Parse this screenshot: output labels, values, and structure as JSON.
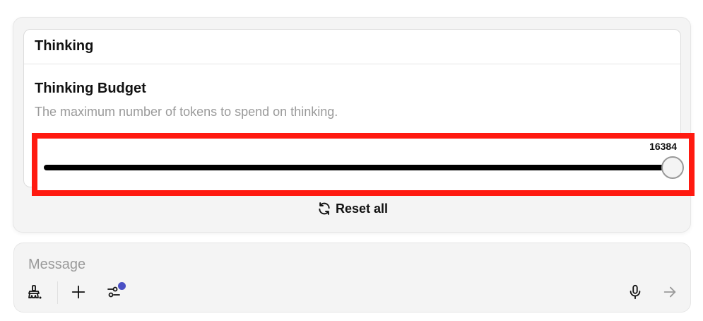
{
  "settings": {
    "section_title": "Thinking",
    "budget": {
      "title": "Thinking Budget",
      "description": "The maximum number of tokens to spend on thinking.",
      "value": "16384",
      "fraction": 1.0
    },
    "reset_label": "Reset all"
  },
  "composer": {
    "placeholder": "Message",
    "icons": [
      "clear-brush-icon",
      "plus-icon",
      "settings-sliders-icon",
      "microphone-icon",
      "send-arrow-icon"
    ],
    "colors": {
      "notification_dot": "#4a4fc4"
    }
  },
  "colors": {
    "highlight": "#ff1a10"
  }
}
